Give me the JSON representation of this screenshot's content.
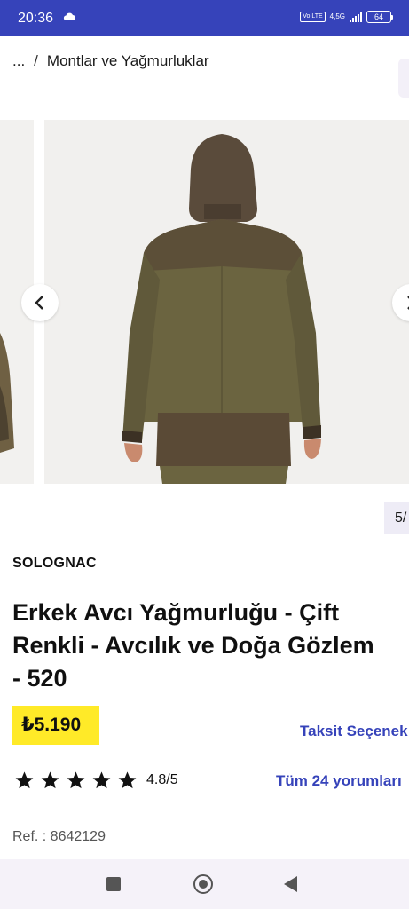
{
  "status_bar": {
    "time": "20:36",
    "volte": "Vo LTE",
    "network": "4,5G",
    "battery": "64",
    "bg_color": "#3643ba"
  },
  "breadcrumb": {
    "ellipsis": "...",
    "separator": "/",
    "current": "Montlar ve Yağmurluklar"
  },
  "gallery": {
    "prev_icon": "chevron-left-icon",
    "next_icon": "chevron-right-icon",
    "counter": "5/"
  },
  "product": {
    "brand": "SOLOGNAC",
    "title_lines": [
      "Erkek Avcı Yağmurluğu - Çift",
      "Renkli - Avcılık ve Doğa Gözlem",
      "- 520"
    ],
    "price": "₺5.190",
    "price_bg": "#ffea28",
    "installments_link": "Taksit Seçenek",
    "rating_text": "4.8/5",
    "rating_value": 4.8,
    "stars_filled": 5,
    "reviews_link": "Tüm 24 yorumları",
    "ref": "Ref. : 8642129",
    "accent_color": "#3643ba"
  },
  "system_nav": {
    "recents_icon": "square-icon",
    "home_icon": "home-circle-icon",
    "back_icon": "back-triangle-icon"
  }
}
